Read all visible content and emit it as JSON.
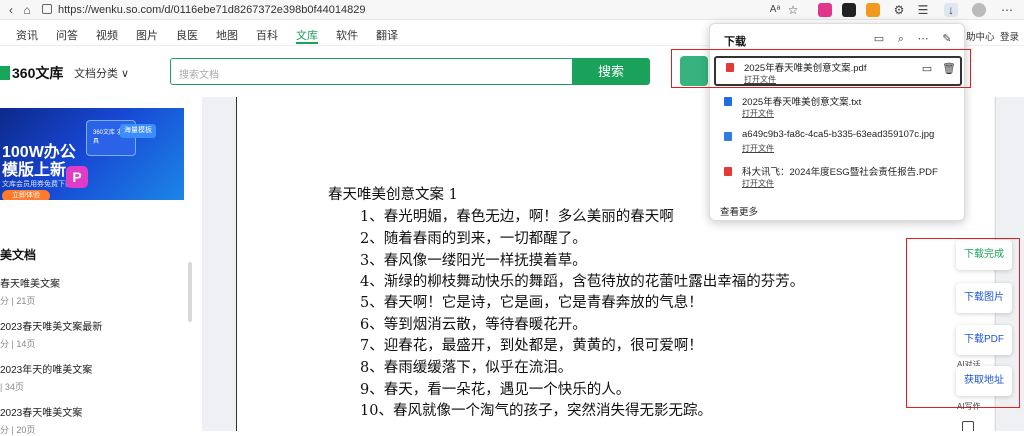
{
  "browser": {
    "url": "https://wenku.so.com/d/0116ebe71d8267372e398b0f44014829",
    "read_aloud_label": "Aᵃ"
  },
  "nav": {
    "items": [
      "资讯",
      "问答",
      "视频",
      "图片",
      "良医",
      "地图",
      "百科",
      "文库",
      "软件",
      "翻译"
    ],
    "active": "文库",
    "right_items": [
      "助中心",
      "登录"
    ]
  },
  "header": {
    "logo_text": "360文库",
    "category_label": "文档分类 ∨",
    "search_placeholder": "搜索文档",
    "search_button": "搜索"
  },
  "banner": {
    "line1": "100W办公",
    "line2": "模版上新",
    "line3": "文库会员用券免费下载",
    "button": "立即体验",
    "p_glyph": "P",
    "card1": "360文库\n求职工具",
    "card2": "海量模板"
  },
  "sidebar": {
    "section_title": "美文档",
    "items": [
      {
        "title": "春天唯美文案",
        "meta": "分 | 21页"
      },
      {
        "title": "2023春天唯美文案最新",
        "meta": "分 | 14页"
      },
      {
        "title": "2023年天的唯美文案",
        "meta": "| 34页"
      },
      {
        "title": "2023春天唯美文案",
        "meta": "分 | 20页"
      }
    ]
  },
  "document": {
    "heading": "春天唯美创意文案 1",
    "lines": [
      "1、春光明媚，春色无边，啊！多么美丽的春天啊",
      "2、随着春雨的到来，一切都醒了。",
      "3、春风像一缕阳光一样抚摸着草。",
      "4、渐绿的柳枝舞动快乐的舞蹈，含苞待放的花蕾吐露出幸福的芬芳。",
      "5、春天啊！它是诗，它是画，它是青春奔放的气息！",
      "6、等到烟消云散，等待春暖花开。",
      "7、迎春花，最盛开，到处都是，黄黄的，很可爱啊！",
      "8、春雨缓缓落下，似乎在流泪。",
      "9、春天，看一朵花，遇见一个快乐的人。",
      "10、春风就像一个淘气的孩子，突然消失得无影无踪。"
    ]
  },
  "downloads": {
    "title": "下载",
    "items": [
      {
        "name": "2025年春天唯美创意文案.pdf",
        "action": "打开文件",
        "type": "pdf",
        "color": "#e53935"
      },
      {
        "name": "2025年春天唯美创意文案.txt",
        "action": "打开文件",
        "type": "txt",
        "color": "#1e6fd9"
      },
      {
        "name": "a649c9b3-fa8c-4ca5-b335-63ead359107c.jpg",
        "action": "打开文件",
        "type": "jpg",
        "color": "#2f7de1"
      },
      {
        "name": "科大讯飞：2024年度ESG暨社会责任报告.PDF",
        "action": "打开文件",
        "type": "pdf",
        "color": "#e53935"
      }
    ],
    "more": "查看更多"
  },
  "floating": {
    "buttons": [
      "下载完成",
      "下载图片",
      "下载PDF",
      "获取地址"
    ],
    "ai_labels": [
      "AI对话",
      "AI写作"
    ]
  },
  "colors": {
    "brand_green": "#1aa25a",
    "highlight_red": "#e02020",
    "link_blue": "#1a55d6"
  }
}
